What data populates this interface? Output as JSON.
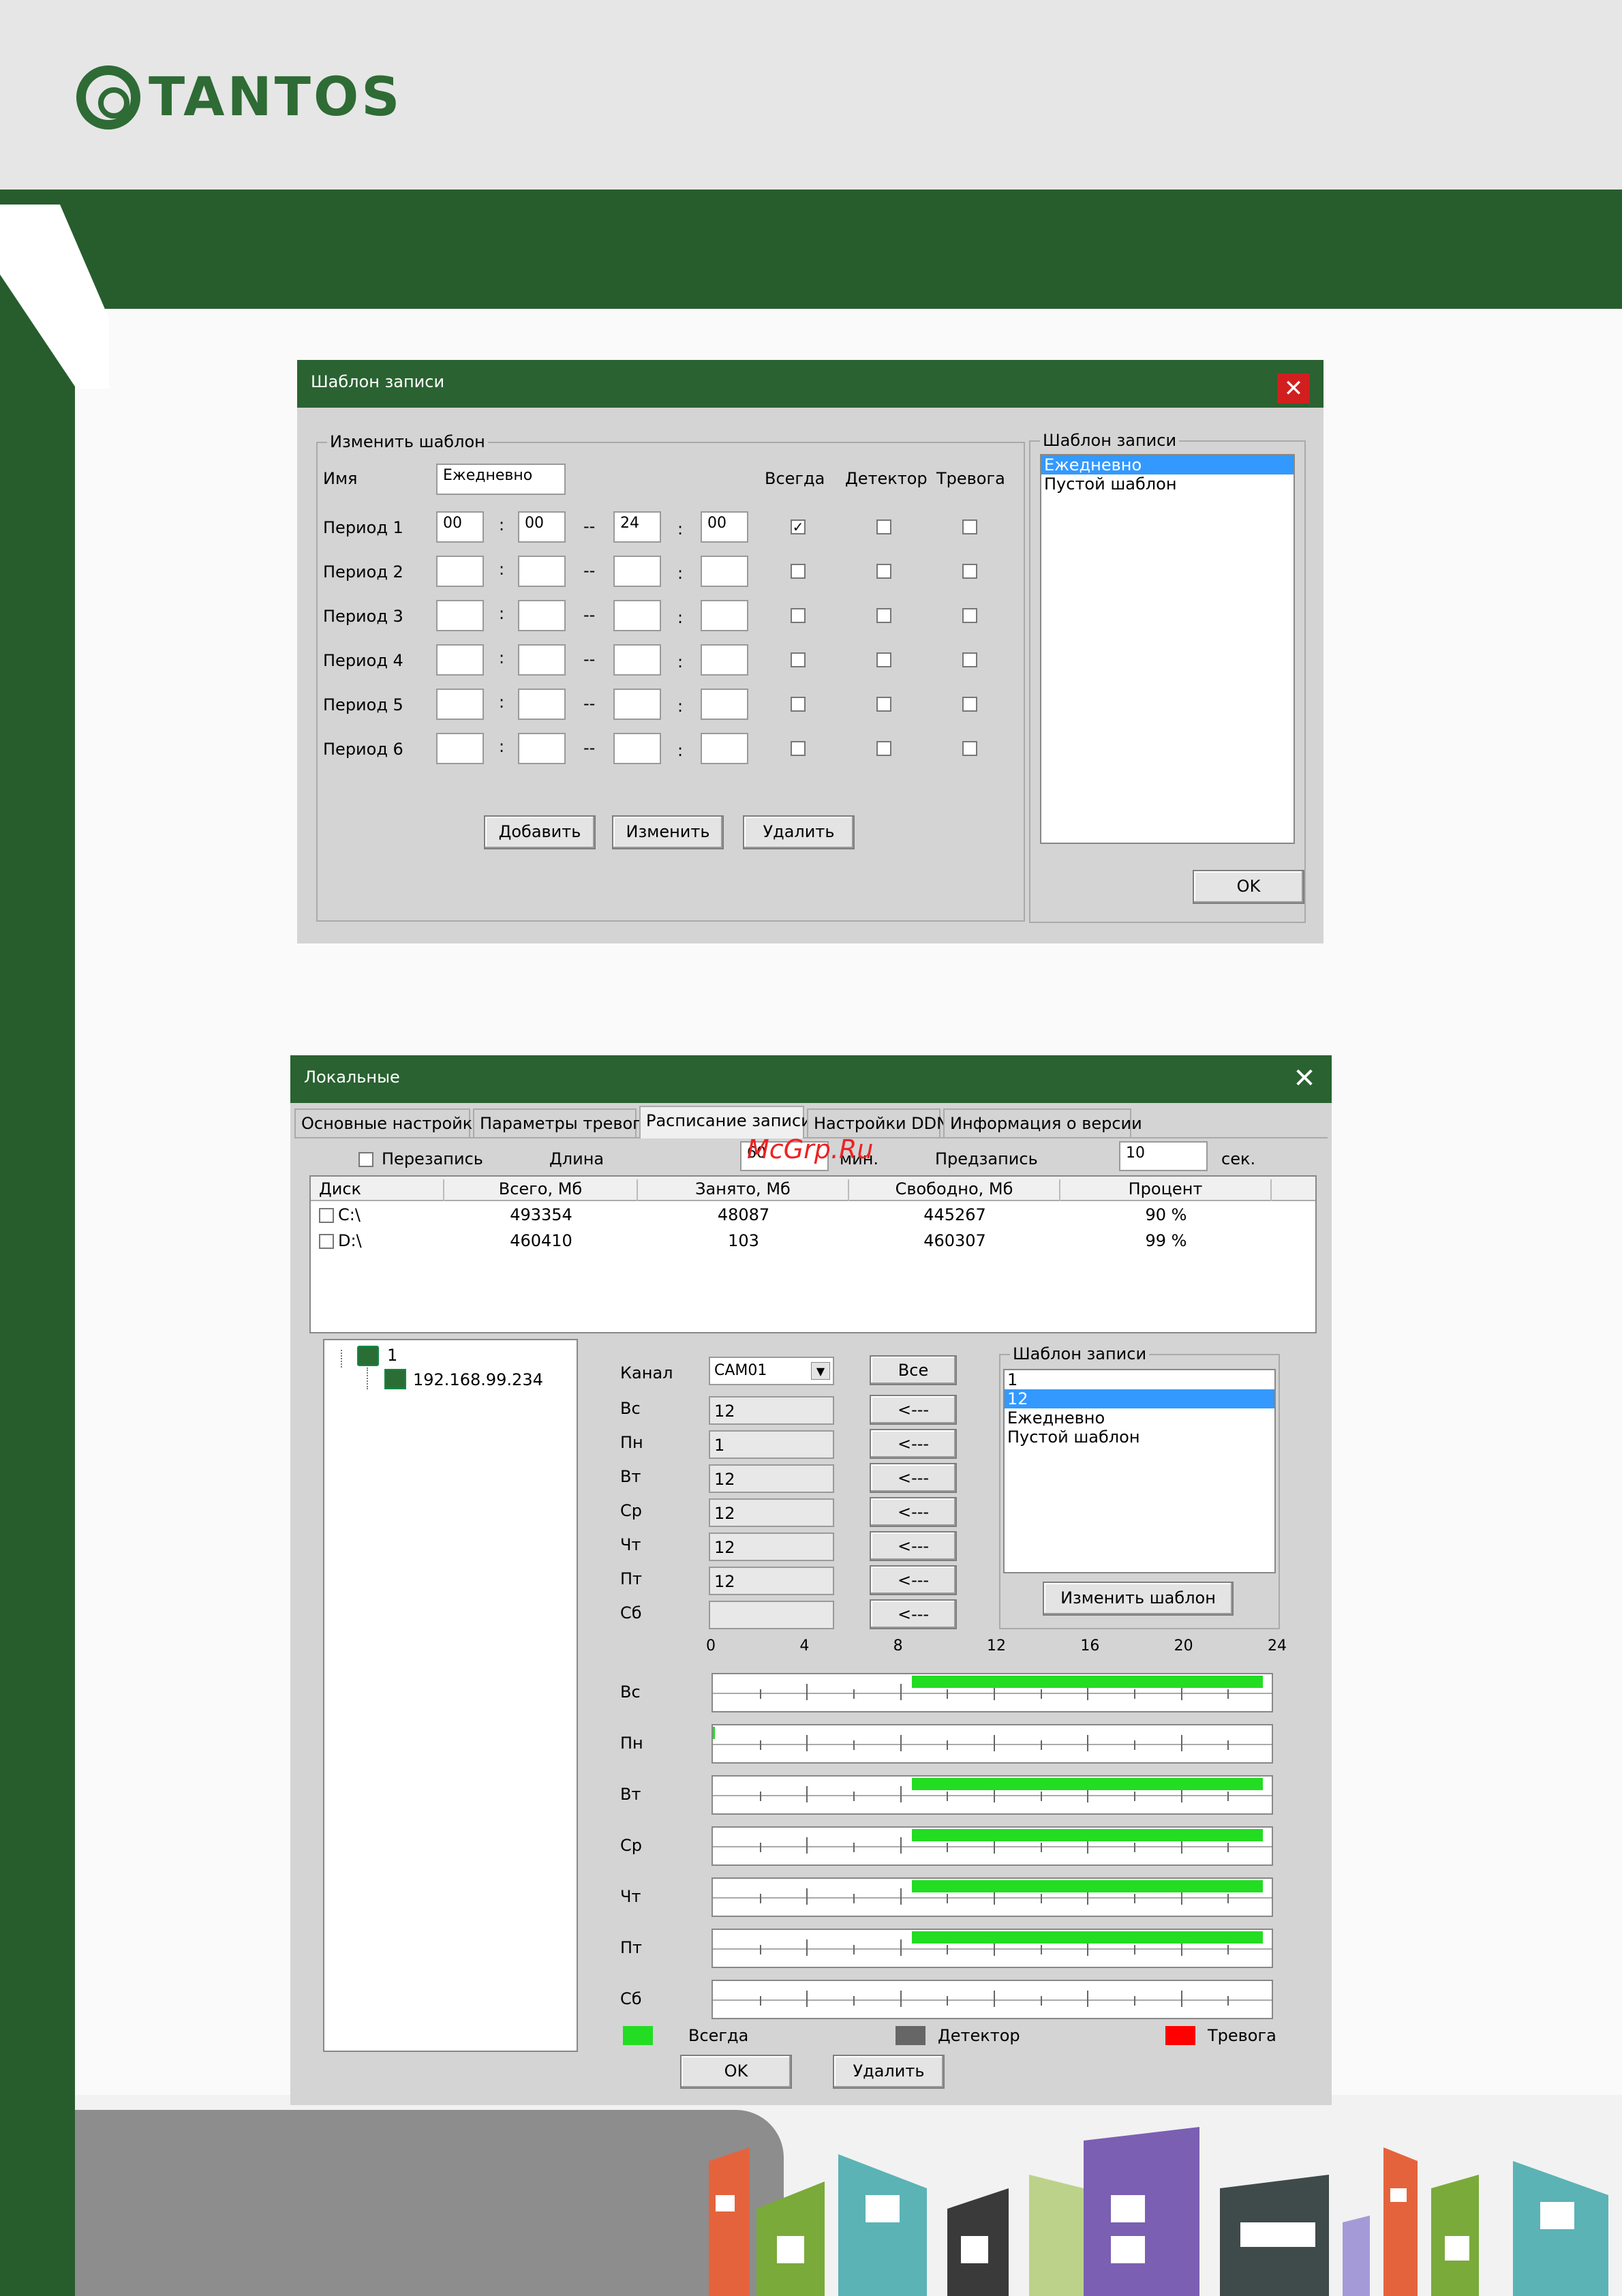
{
  "brand": {
    "logo_text": "TANTOS"
  },
  "watermark": "McGrp.Ru",
  "template_window": {
    "title": "Шаблон записи",
    "edit_group_title": "Изменить шаблон",
    "name_label": "Имя",
    "name_value": "Ежедневно",
    "col_always": "Всегда",
    "col_detector": "Детектор",
    "col_alarm": "Тревога",
    "periods": [
      {
        "label": "Период 1",
        "h1": "00",
        "m1": "00",
        "h2": "24",
        "m2": "00",
        "always": true,
        "detector": false,
        "alarm": false
      },
      {
        "label": "Период 2",
        "h1": "",
        "m1": "",
        "h2": "",
        "m2": "",
        "always": false,
        "detector": false,
        "alarm": false
      },
      {
        "label": "Период 3",
        "h1": "",
        "m1": "",
        "h2": "",
        "m2": "",
        "always": false,
        "detector": false,
        "alarm": false
      },
      {
        "label": "Период 4",
        "h1": "",
        "m1": "",
        "h2": "",
        "m2": "",
        "always": false,
        "detector": false,
        "alarm": false
      },
      {
        "label": "Период 5",
        "h1": "",
        "m1": "",
        "h2": "",
        "m2": "",
        "always": false,
        "detector": false,
        "alarm": false
      },
      {
        "label": "Период 6",
        "h1": "",
        "m1": "",
        "h2": "",
        "m2": "",
        "always": false,
        "detector": false,
        "alarm": false
      }
    ],
    "colon": ":",
    "dash": "--",
    "add_button": "Добавить",
    "change_button": "Изменить",
    "delete_button": "Удалить",
    "list_group_title": "Шаблон записи",
    "list_items": [
      {
        "text": "Ежедневно",
        "selected": true
      },
      {
        "text": "Пустой шаблон",
        "selected": false
      }
    ],
    "ok_button": "OK"
  },
  "local_window": {
    "title": "Локальные",
    "tabs": [
      {
        "label": "Основные настройки",
        "active": false
      },
      {
        "label": "Параметры тревоги",
        "active": false
      },
      {
        "label": "Расписание записи",
        "active": true
      },
      {
        "label": "Настройки DDNS",
        "active": false
      },
      {
        "label": "Информация о версии",
        "active": false
      }
    ],
    "overwrite_label": "Перезапись",
    "length_label": "Длина",
    "length_value": "60",
    "length_unit": "мин.",
    "prerecord_label": "Предзапись",
    "prerecord_value": "10",
    "prerecord_unit": "сек.",
    "disk_headers": [
      "Диск",
      "Всего, Мб",
      "Занято, Мб",
      "Свободно, Мб",
      "Процент"
    ],
    "disks": [
      {
        "name": "C:\\",
        "total": "493354",
        "used": "48087",
        "free": "445267",
        "percent": "90 %"
      },
      {
        "name": "D:\\",
        "total": "460410",
        "used": "103",
        "free": "460307",
        "percent": "99 %"
      }
    ],
    "tree_root": "1",
    "tree_child": "192.168.99.234",
    "channel_label": "Канал",
    "channel_value": "CAM01",
    "all_button": "Все",
    "arrow_button": "<---",
    "days": [
      {
        "label": "Вс",
        "value": "12"
      },
      {
        "label": "Пн",
        "value": "1"
      },
      {
        "label": "Вт",
        "value": "12"
      },
      {
        "label": "Ср",
        "value": "12"
      },
      {
        "label": "Чт",
        "value": "12"
      },
      {
        "label": "Пт",
        "value": "12"
      },
      {
        "label": "Сб",
        "value": ""
      }
    ],
    "template_group_title": "Шаблон записи",
    "template_list": [
      {
        "text": "1",
        "selected": false
      },
      {
        "text": "12",
        "selected": true
      },
      {
        "text": "Ежедневно",
        "selected": false
      },
      {
        "text": "Пустой шаблон",
        "selected": false
      }
    ],
    "change_template_button": "Изменить шаблон",
    "hour_ticks": [
      "0",
      "4",
      "8",
      "12",
      "16",
      "20",
      "24"
    ],
    "timeline": [
      {
        "label": "Вс",
        "from": 8.5,
        "to": 23.5
      },
      {
        "label": "Пн",
        "from": 0,
        "to": 0.1
      },
      {
        "label": "Вт",
        "from": 8.5,
        "to": 23.5
      },
      {
        "label": "Ср",
        "from": 8.5,
        "to": 23.5
      },
      {
        "label": "Чт",
        "from": 8.5,
        "to": 23.5
      },
      {
        "label": "Пт",
        "from": 8.5,
        "to": 23.5
      },
      {
        "label": "Сб",
        "from": 0,
        "to": 0
      }
    ],
    "legend": [
      {
        "label": "Всегда",
        "color": "#22dd22"
      },
      {
        "label": "Детектор",
        "color": "#666666"
      },
      {
        "label": "Тревога",
        "color": "#ff0000"
      }
    ],
    "ok_button": "OK",
    "delete_button": "Удалить"
  }
}
